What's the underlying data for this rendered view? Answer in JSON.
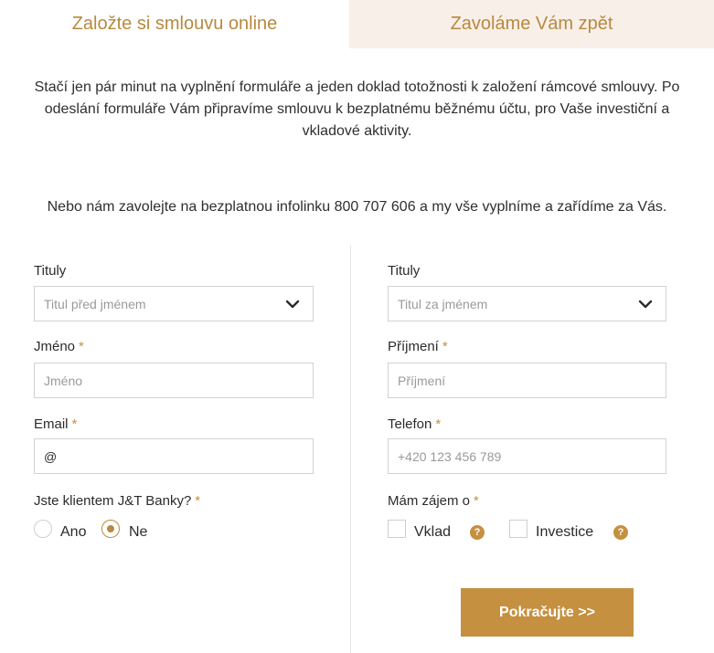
{
  "tabs": [
    {
      "label": "Založte si smlouvu online",
      "active": true
    },
    {
      "label": "Zavoláme Vám zpět",
      "active": false
    }
  ],
  "intro": "Stačí jen pár minut na vyplnění formuláře a jeden doklad totožnosti k založení rámcové smlouvy. Po odeslání formuláře Vám připravíme smlouvu k bezplatnému běžnému účtu, pro Vaše investiční a vkladové aktivity.",
  "hotline": "Nebo nám zavolejte na bezplatnou infolinku 800 707 606 a my vše vyplníme a zařídíme za Vás.",
  "required_mark": "*",
  "left": {
    "title_before": {
      "label": "Tituly",
      "placeholder": "Titul před jménem"
    },
    "first_name": {
      "label": "Jméno",
      "placeholder": "Jméno"
    },
    "email": {
      "label": "Email",
      "value": "@"
    },
    "is_client": {
      "label": "Jste klientem J&T Banky?",
      "options": [
        "Ano",
        "Ne"
      ],
      "selected": "Ne"
    }
  },
  "right": {
    "title_after": {
      "label": "Tituly",
      "placeholder": "Titul za jménem"
    },
    "last_name": {
      "label": "Příjmení",
      "placeholder": "Příjmení"
    },
    "phone": {
      "label": "Telefon",
      "placeholder": "+420 123 456 789"
    },
    "interest": {
      "label": "Mám zájem o",
      "options": [
        "Vklad",
        "Investice"
      ],
      "help_glyph": "?"
    }
  },
  "submit_label": "Pokračujte >>",
  "colors": {
    "accent": "#c5903f",
    "tab_inactive_bg": "#f8efe8",
    "tab_text": "#b8893f",
    "border": "#d2d2d2"
  },
  "icons": {
    "select": "chevron-down-icon",
    "help": "help-icon"
  }
}
